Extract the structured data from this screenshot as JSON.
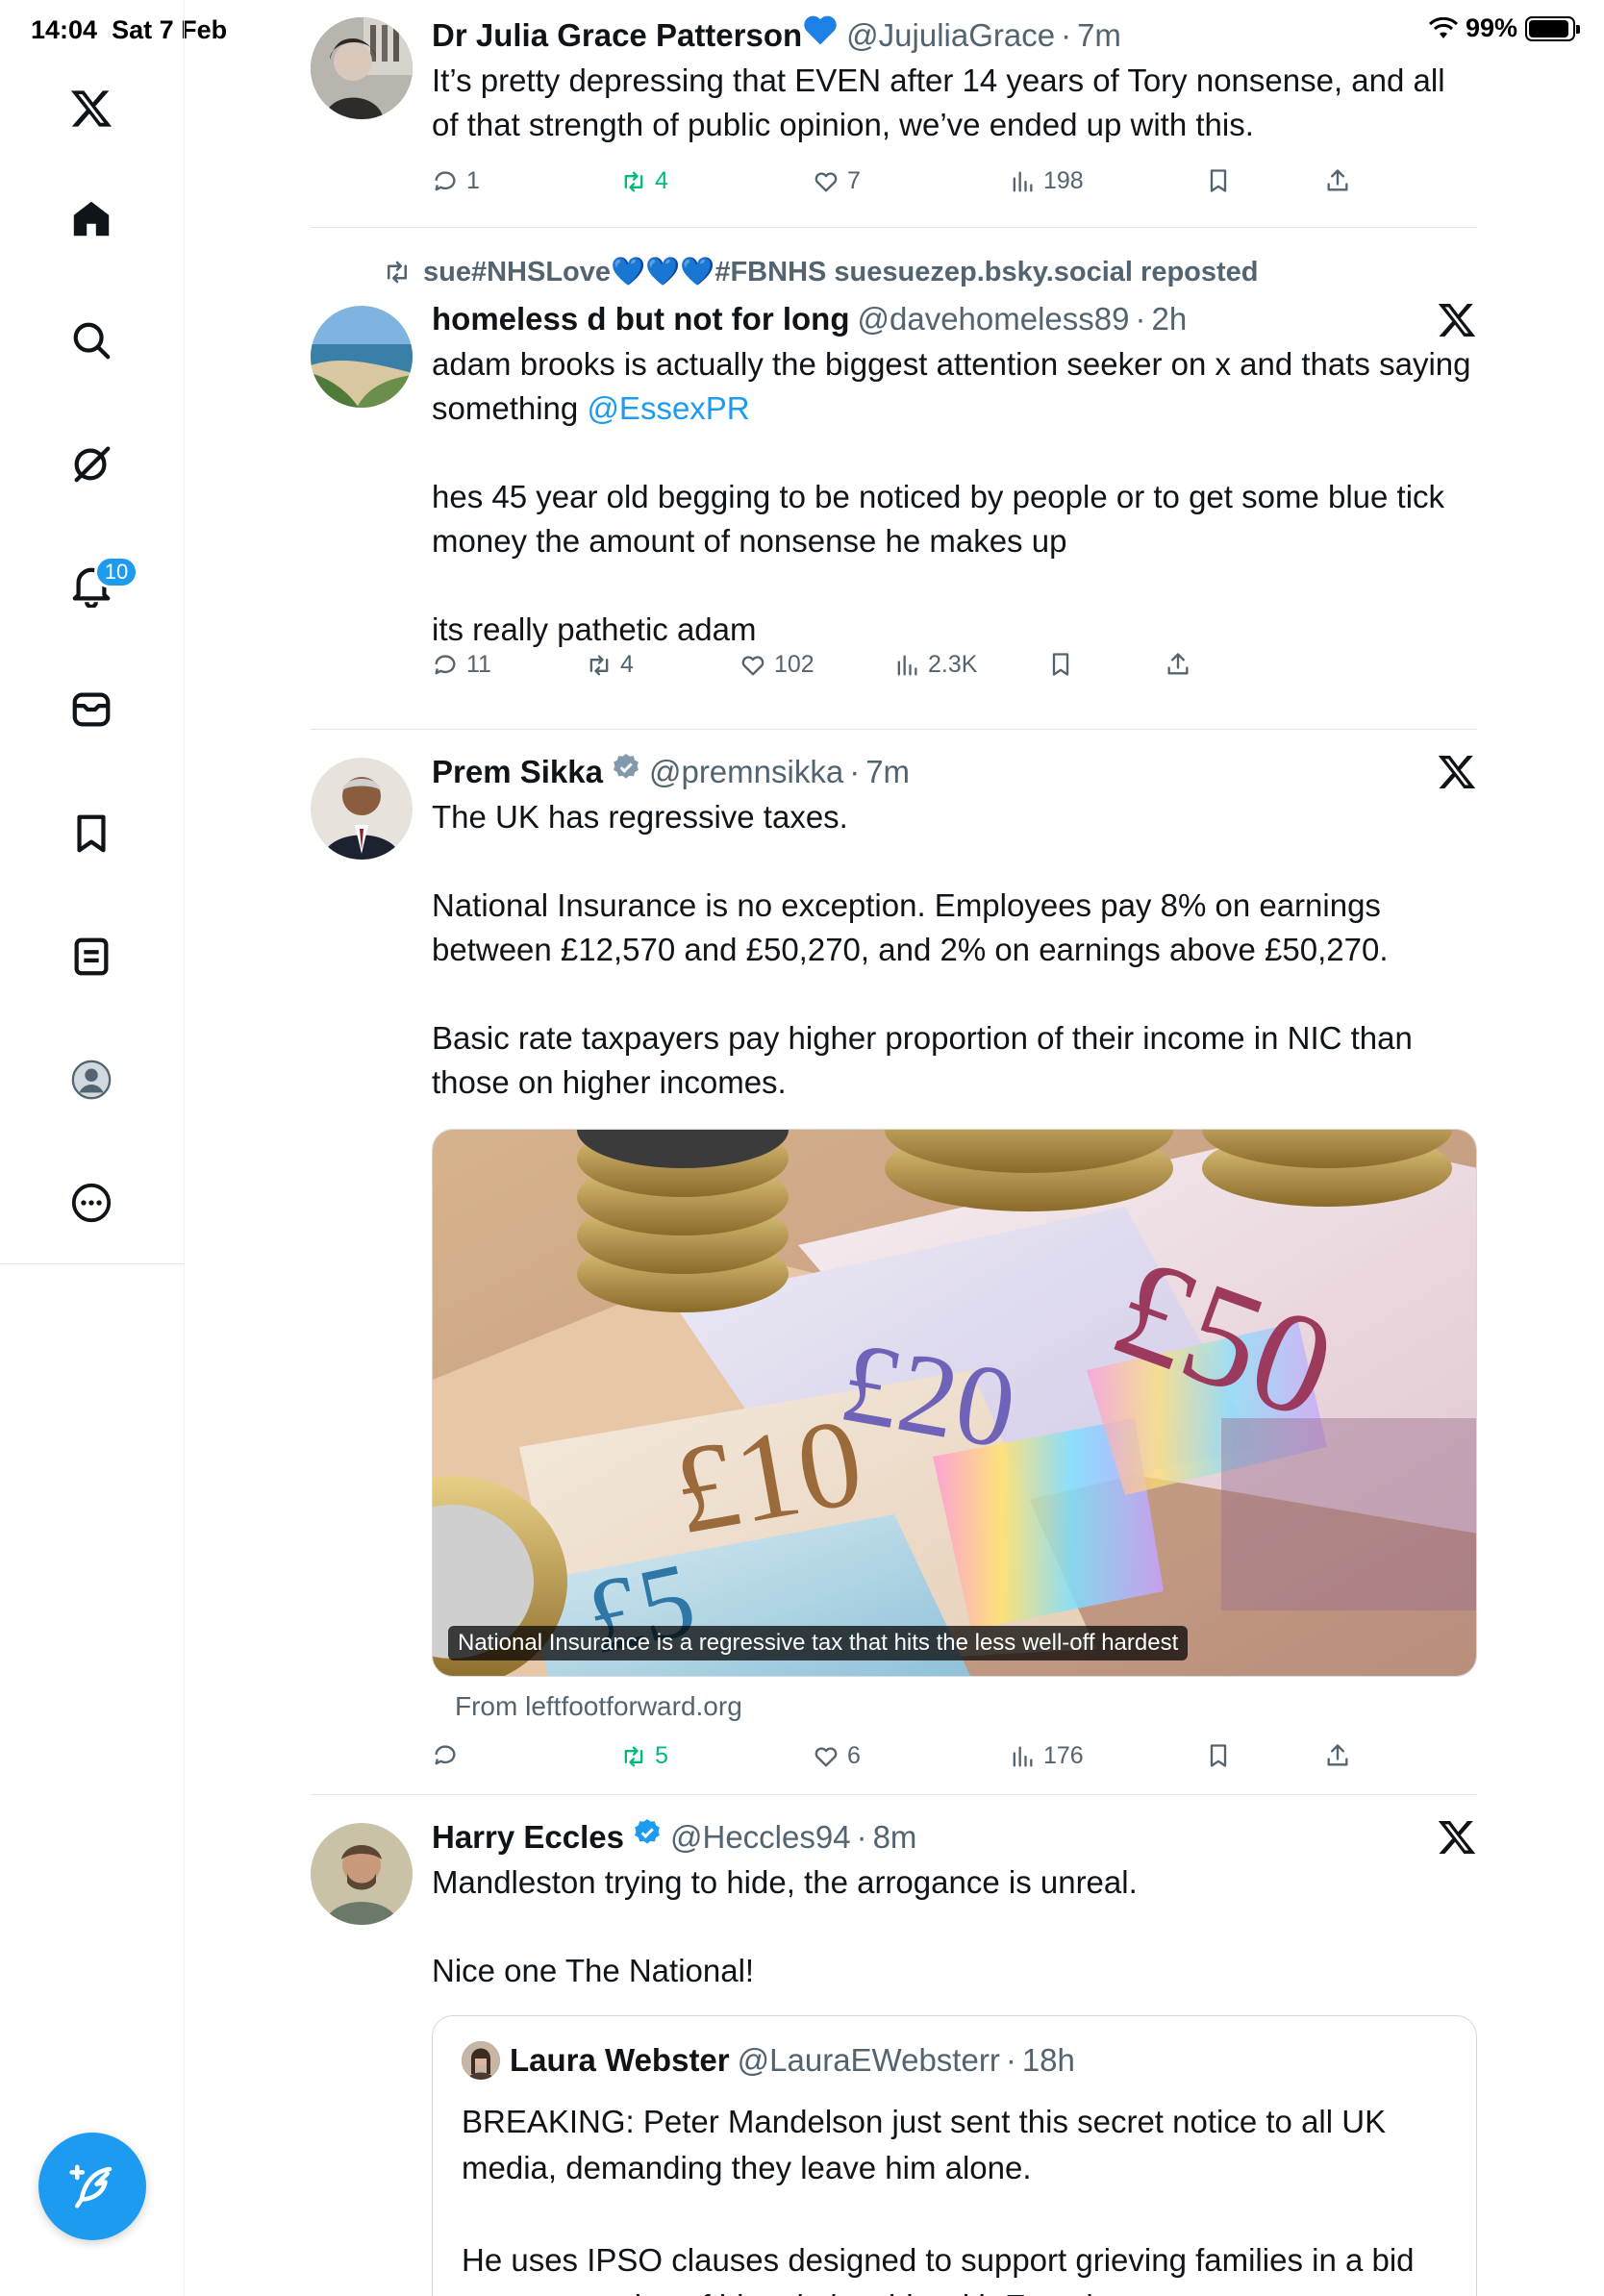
{
  "status_bar": {
    "time": "14:04",
    "date": "Sat 7 Feb",
    "battery": "99%",
    "battery_level_percent": 99
  },
  "sidebar": {
    "items": [
      {
        "name": "x-logo-icon"
      },
      {
        "name": "home-icon"
      },
      {
        "name": "search-icon"
      },
      {
        "name": "grok-icon"
      },
      {
        "name": "notifications-icon",
        "badge": "10"
      },
      {
        "name": "messages-icon"
      },
      {
        "name": "bookmarks-icon"
      },
      {
        "name": "lists-icon"
      },
      {
        "name": "profile-icon"
      },
      {
        "name": "more-icon"
      }
    ],
    "compose_icon": "compose-icon"
  },
  "tweets": [
    {
      "name": "Dr Julia Grace Patterson",
      "handle": "@JujuliaGrace",
      "dot": "·",
      "time": "7m",
      "text": "It’s pretty depressing that EVEN after 14 years of Tory nonsense, and all of that strength of public opinion, we’ve ended up with this.",
      "replies": "1",
      "reposts": "4",
      "likes": "7",
      "views": "198"
    },
    {
      "repost_line": "sue#NHSLove💙💙💙#FBNHS suesuezep.bsky.social reposted",
      "name": "homeless d but not for long",
      "handle": "@davehomeless89",
      "dot": "·",
      "time": "2h",
      "text_a": "adam brooks is actually the biggest attention seeker on x and thats saying something ",
      "mention": "@EssexPR",
      "text_b": "hes 45 year old begging to be noticed by people or to get some blue tick money the amount of nonsense he makes up\n\nits really pathetic adam",
      "replies": "11",
      "reposts": "4",
      "likes": "102",
      "views": "2.3K"
    },
    {
      "name": "Prem Sikka",
      "handle": "@premnsikka",
      "dot": "·",
      "time": "7m",
      "text": "The UK has regressive taxes.\n\nNational Insurance is no exception. Employees pay 8% on earnings between £12,570 and £50,270, and 2% on earnings above £50,270.\n\nBasic rate taxpayers pay higher proportion of their income in NIC than those on higher incomes.",
      "media_caption": "National Insurance is a regressive tax that hits the less well-off hardest",
      "note_50": "£50",
      "note_20": "£20",
      "note_10": "£10",
      "note_5": "£5",
      "from": "From leftfootforward.org",
      "replies": "",
      "reposts": "5",
      "likes": "6",
      "views": "176"
    },
    {
      "name": "Harry Eccles",
      "handle": "@Heccles94",
      "dot": "·",
      "time": "8m",
      "text": "Mandleston trying to hide, the arrogance is unreal.\n\nNice one The National!",
      "quote": {
        "name": "Laura Webster",
        "handle": "@LauraEWebsterr",
        "dot": "·",
        "time": "18h",
        "text": "BREAKING: Peter Mandelson just sent this secret notice to all UK media, demanding they leave him alone.\n\nHe uses IPSO clauses designed to support grieving families in a bid to stop scrutiny of his relationship with Epstein."
      }
    }
  ],
  "colors": {
    "accent": "#1d9bf0",
    "repost_green": "#00ba7c",
    "secondary_text": "#536471",
    "border": "#e1e6e8"
  }
}
